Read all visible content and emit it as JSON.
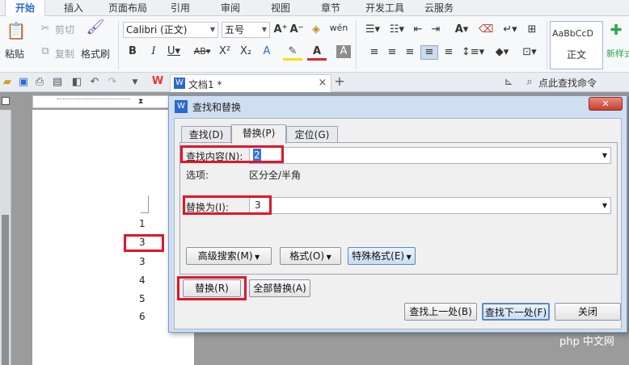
{
  "menubar": {
    "items": [
      "开始",
      "插入",
      "页面布局",
      "引用",
      "审阅",
      "视图",
      "章节",
      "开发工具",
      "云服务"
    ]
  },
  "ribbon": {
    "paste_label": "粘贴",
    "cut_label": "剪切",
    "copy_label": "复制",
    "format_painter_label": "格式刷",
    "font_name": "Calibri (正文)",
    "font_size": "五号",
    "style_preview": "AaBbCcD",
    "style_name": "正文",
    "new_style_label": "新样式"
  },
  "qat": {
    "doc_tab_label": "文档1 *",
    "search_label": "点此查找命令"
  },
  "document": {
    "numbers": [
      "1",
      "3",
      "3",
      "4",
      "5",
      "6"
    ]
  },
  "dialog": {
    "title": "查找和替换",
    "close_symbol": "✕",
    "tabs": [
      "查找(D)",
      "替换(P)",
      "定位(G)"
    ],
    "find_label": "查找内容(N):",
    "find_value": "2",
    "options_label": "选项:",
    "options_value": "区分全/半角",
    "replace_label": "替换为(I):",
    "replace_value": "3",
    "advanced_search_label": "高级搜索(M)",
    "format_label": "格式(O)",
    "special_format_label": "特殊格式(E)",
    "replace_button": "替换(R)",
    "replace_all_button": "全部替换(A)",
    "find_prev_button": "查找上一处(B)",
    "find_next_button": "查找下一处(F)",
    "close_button": "关闭"
  },
  "watermark": "php 中文网",
  "colors": {
    "accent_red": "#e0162b",
    "dialog_frame": "#cfdff1",
    "active_tab": "#2a6ad0"
  }
}
